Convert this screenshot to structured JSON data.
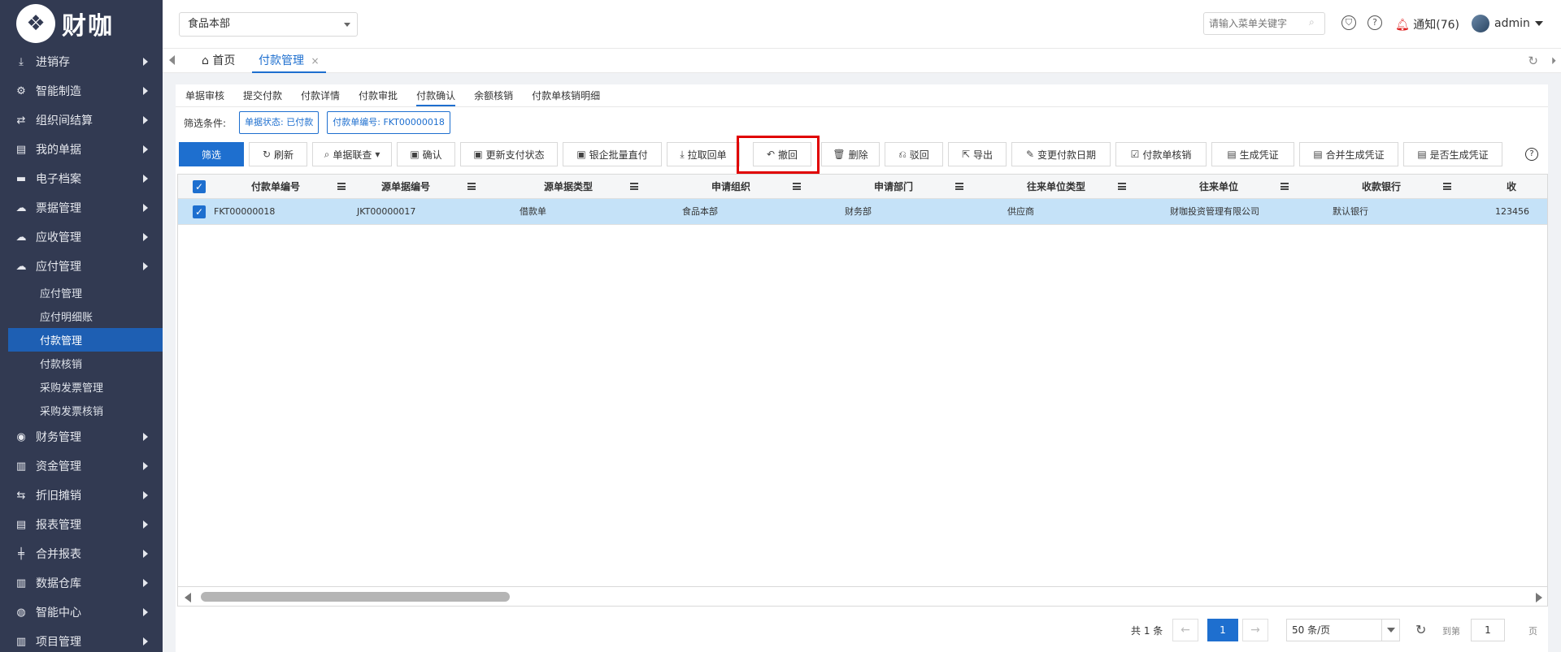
{
  "app": {
    "logo_text": "财咖"
  },
  "sidebar": {
    "items": [
      {
        "label": "进销存",
        "icon": "download-icon",
        "glyph": "⤓"
      },
      {
        "label": "智能制造",
        "icon": "gears-icon",
        "glyph": "⚙"
      },
      {
        "label": "组织间结算",
        "icon": "transfer-icon",
        "glyph": "⇄"
      },
      {
        "label": "我的单据",
        "icon": "document-icon",
        "glyph": "▤"
      },
      {
        "label": "电子档案",
        "icon": "archive-icon",
        "glyph": "▬"
      },
      {
        "label": "票据管理",
        "icon": "cloud-upload-icon",
        "glyph": "☁"
      },
      {
        "label": "应收管理",
        "icon": "cloud-upload-icon",
        "glyph": "☁"
      },
      {
        "label": "应付管理",
        "icon": "cloud-download-icon",
        "glyph": "☁"
      }
    ],
    "sub_items": [
      "应付管理",
      "应付明细账",
      "付款管理",
      "付款核销",
      "采购发票管理",
      "采购发票核销"
    ],
    "active_sub": "付款管理",
    "items_after": [
      {
        "label": "财务管理",
        "icon": "finance-icon",
        "glyph": "◉"
      },
      {
        "label": "资金管理",
        "icon": "bar-chart-icon",
        "glyph": "▥"
      },
      {
        "label": "折旧摊销",
        "icon": "cycle-icon",
        "glyph": "⇆"
      },
      {
        "label": "报表管理",
        "icon": "report-icon",
        "glyph": "▤"
      },
      {
        "label": "合并报表",
        "icon": "merge-icon",
        "glyph": "╪"
      },
      {
        "label": "数据仓库",
        "icon": "bar-chart-icon",
        "glyph": "▥"
      },
      {
        "label": "智能中心",
        "icon": "globe-icon",
        "glyph": "◍"
      },
      {
        "label": "项目管理",
        "icon": "bar-chart-icon",
        "glyph": "▥"
      }
    ]
  },
  "topbar": {
    "org": "食品本部",
    "search_placeholder": "请输入菜单关键字",
    "notify_label": "通知(76)",
    "user": "admin"
  },
  "tabs": {
    "home": "首页",
    "current": "付款管理"
  },
  "subtabs": [
    "单据审核",
    "提交付款",
    "付款详情",
    "付款审批",
    "付款确认",
    "余额核销",
    "付款单核销明细"
  ],
  "active_subtab": "付款确认",
  "filter": {
    "label": "筛选条件:",
    "chips": [
      "单据状态: 已付款",
      "付款单编号: FKT00000018"
    ]
  },
  "toolbar": {
    "filter": "筛选",
    "refresh": "刷新",
    "linked": "单据联查",
    "confirm": "确认",
    "update_status": "更新支付状态",
    "bank_direct": "银企批量直付",
    "pull_receipt": "拉取回单",
    "withdraw": "撤回",
    "delete": "删除",
    "reject": "驳回",
    "export": "导出",
    "change_date": "变更付款日期",
    "verify": "付款单核销",
    "gen_voucher": "生成凭证",
    "merge_voucher": "合并生成凭证",
    "is_voucher": "是否生成凭证"
  },
  "table": {
    "columns": [
      "付款单编号",
      "源单据编号",
      "源单据类型",
      "申请组织",
      "申请部门",
      "往来单位类型",
      "往来单位",
      "收款银行",
      "收"
    ],
    "rows": [
      [
        "FKT00000018",
        "JKT00000017",
        "借款单",
        "食品本部",
        "财务部",
        "供应商",
        "财咖投资管理有限公司",
        "默认银行",
        "123456"
      ]
    ]
  },
  "pager": {
    "total": "共 1 条",
    "current": "1",
    "page_size": "50 条/页",
    "goto": "到第",
    "input": "1",
    "page_unit": "页"
  }
}
